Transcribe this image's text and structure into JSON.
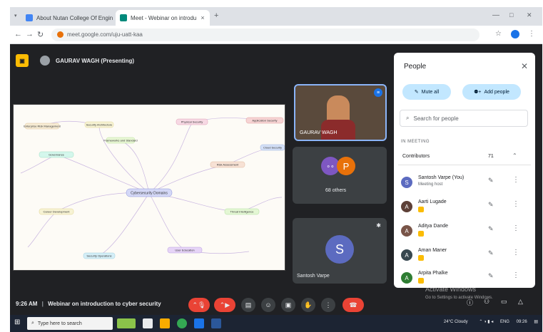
{
  "browser": {
    "tabs": [
      {
        "label": "About Nutan College Of Engin",
        "close": "×"
      },
      {
        "label": "Meet - Webinar on introdu",
        "close": "×"
      }
    ],
    "new_tab": "+",
    "window_controls": [
      "—",
      "□",
      "✕"
    ],
    "url": "meet.google.com/uju-uatt-kaa"
  },
  "meet": {
    "presenter": "GAURAV WAGH (Presenting)",
    "tiles": [
      {
        "name": "GAURAV WAGH"
      },
      {
        "name": "68 others",
        "avatar_letter": "P"
      },
      {
        "name": "Santosh Varpe",
        "avatar_letter": "S"
      }
    ],
    "mindmap_center": "Cybersecurity Domains",
    "mindmap_nodes": [
      "Security Architecture",
      "Physical Security",
      "Risk Assessment",
      "Threat Intelligence",
      "User Education",
      "Security Operations",
      "Career Development",
      "Governance",
      "Frameworks and Standard",
      "Enterprise Risk Management",
      "Application Security",
      "Cloud Security"
    ],
    "time": "9:26 AM",
    "meeting_title": "Webinar on introduction to cyber security"
  },
  "people_panel": {
    "title": "People",
    "mute_all": "Mute all",
    "add_people": "Add people",
    "search_placeholder": "Search for people",
    "section": "IN MEETING",
    "group": "Contributors",
    "count": "71",
    "people": [
      {
        "name": "Santosh Varpe (You)",
        "sub": "Meeting host",
        "initial": "S",
        "color": "#5c6bc0"
      },
      {
        "name": "Aarti Lugade",
        "initial": "A",
        "color": "#5d4037"
      },
      {
        "name": "Aditya Dande",
        "initial": "A",
        "color": "#795548"
      },
      {
        "name": "Aman Maner",
        "initial": "A",
        "color": "#37474f"
      },
      {
        "name": "Arpita Phalke",
        "initial": "A",
        "color": "#2e7d32"
      }
    ]
  },
  "watermark": {
    "title": "Activate Windows",
    "sub": "Go to Settings to activate Windows."
  },
  "taskbar": {
    "search_placeholder": "Type here to search",
    "weather": "24°C Cloudy",
    "lang": "ENG",
    "clock": "09:26"
  }
}
